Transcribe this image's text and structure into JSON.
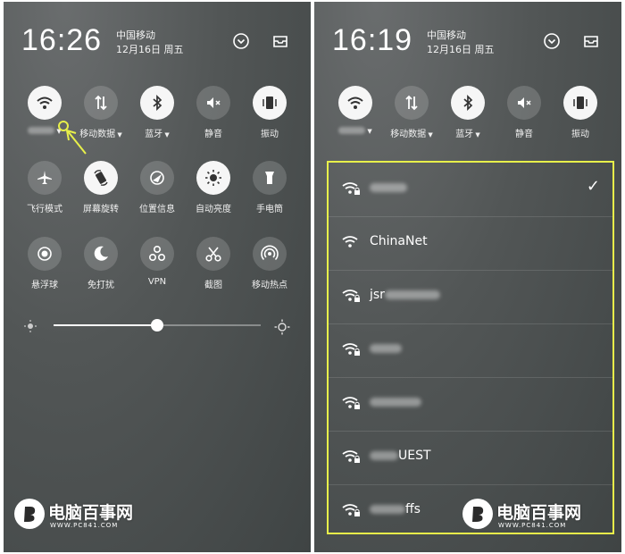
{
  "left": {
    "time": "16:26",
    "carrier": "中国移动",
    "date": "12月16日 周五",
    "rows": [
      [
        {
          "label": "",
          "icon": "wifi-icon",
          "on": true,
          "caret": true,
          "blurred": true
        },
        {
          "label": "移动数据",
          "icon": "mobile-data-icon",
          "on": false,
          "caret": true
        },
        {
          "label": "蓝牙",
          "icon": "bluetooth-icon",
          "on": true,
          "caret": true
        },
        {
          "label": "静音",
          "icon": "mute-icon",
          "on": false
        },
        {
          "label": "振动",
          "icon": "vibrate-icon",
          "on": true
        }
      ],
      [
        {
          "label": "飞行模式",
          "icon": "airplane-icon",
          "on": false
        },
        {
          "label": "屏幕旋转",
          "icon": "rotate-icon",
          "on": true
        },
        {
          "label": "位置信息",
          "icon": "location-icon",
          "on": false
        },
        {
          "label": "自动亮度",
          "icon": "brightness-icon",
          "on": true
        },
        {
          "label": "手电筒",
          "icon": "flashlight-icon",
          "on": false
        }
      ],
      [
        {
          "label": "悬浮球",
          "icon": "float-ball-icon",
          "on": false
        },
        {
          "label": "免打扰",
          "icon": "moon-icon",
          "on": false
        },
        {
          "label": "VPN",
          "icon": "vpn-icon",
          "on": false
        },
        {
          "label": "截图",
          "icon": "scissors-icon",
          "on": false
        },
        {
          "label": "移动热点",
          "icon": "hotspot-icon",
          "on": false
        }
      ]
    ],
    "brightness": 0.5
  },
  "right": {
    "time": "16:19",
    "carrier": "中国移动",
    "date": "12月16日 周五",
    "tiles": [
      {
        "label": "",
        "icon": "wifi-icon",
        "on": true,
        "caret": true,
        "blurred": true
      },
      {
        "label": "移动数据",
        "icon": "mobile-data-icon",
        "on": false,
        "caret": true
      },
      {
        "label": "蓝牙",
        "icon": "bluetooth-icon",
        "on": true,
        "caret": true
      },
      {
        "label": "静音",
        "icon": "mute-icon",
        "on": false
      },
      {
        "label": "振动",
        "icon": "vibrate-icon",
        "on": true
      }
    ],
    "networks": [
      {
        "name": "",
        "blur_width": 42,
        "locked": true,
        "connected": true
      },
      {
        "name": "ChinaNet",
        "blur_width": 0,
        "locked": false,
        "connected": false
      },
      {
        "name": "jsr",
        "blur_after": 62,
        "locked": true,
        "connected": false
      },
      {
        "name": "",
        "blur_width": 36,
        "locked": true,
        "connected": false
      },
      {
        "name": "",
        "blur_width": 58,
        "locked": true,
        "connected": false
      },
      {
        "name": "UEST",
        "blur_before": 32,
        "locked": true,
        "connected": false
      },
      {
        "name": "ffs",
        "blur_before": 40,
        "locked": true,
        "connected": false
      }
    ]
  },
  "watermark": {
    "text": "电脑百事网",
    "url": "WWW.PC841.COM"
  }
}
